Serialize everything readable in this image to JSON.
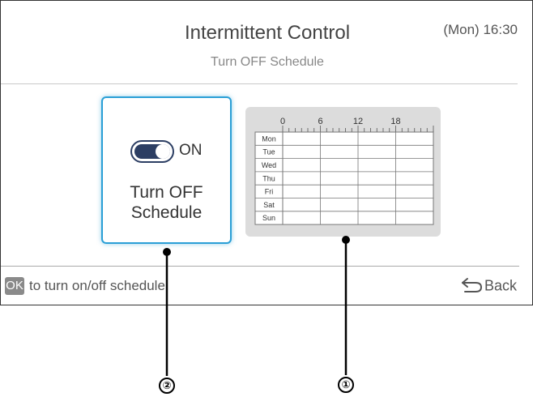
{
  "header": {
    "title": "Intermittent Control",
    "clock": "(Mon) 16:30",
    "subtitle": "Turn OFF Schedule"
  },
  "card": {
    "toggle_state": "ON",
    "toggle_on": true,
    "label_line1": "Turn OFF",
    "label_line2": "Schedule",
    "accent_color": "#2a9fd6"
  },
  "schedule": {
    "hour_labels": [
      "0",
      "6",
      "12",
      "18"
    ],
    "days": [
      "Mon",
      "Tue",
      "Wed",
      "Thu",
      "Fri",
      "Sat",
      "Sun"
    ]
  },
  "footer": {
    "ok_key": "OK",
    "ok_text": "to turn on/off schedule",
    "back_label": "Back"
  },
  "callouts": [
    "②",
    "①"
  ]
}
